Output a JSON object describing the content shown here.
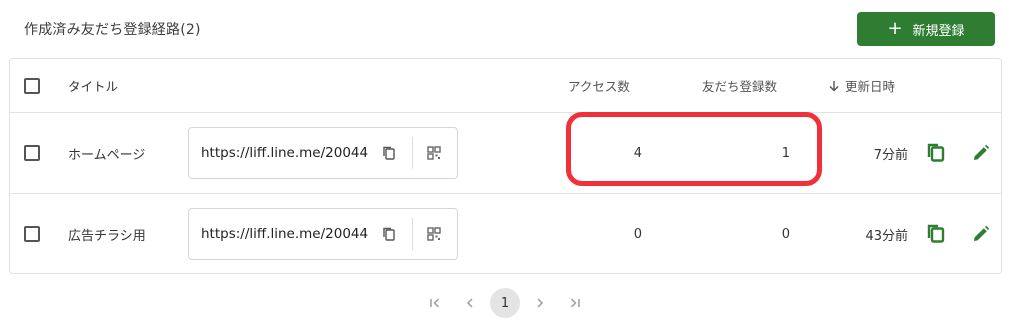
{
  "page": {
    "title": "作成済み友だち登録経路(2)",
    "new_button_label": "新規登録",
    "new_button_icon": "plus-icon"
  },
  "colors": {
    "accent_green": "#2f7d32",
    "highlight_red": "#f2303a"
  },
  "table": {
    "headers": {
      "title": "タイトル",
      "access": "アクセス数",
      "friends": "友だち登録数",
      "updated": "更新日時",
      "sort_icon": "arrow-down-icon"
    },
    "rows": [
      {
        "title": "ホームページ",
        "url": "https://liff.line.me/20044",
        "access": "4",
        "friends": "1",
        "updated": "7分前"
      },
      {
        "title": "広告チラシ用",
        "url": "https://liff.line.me/20044",
        "access": "0",
        "friends": "0",
        "updated": "43分前"
      }
    ]
  },
  "pagination": {
    "current": "1",
    "icons": [
      "first-page-icon",
      "prev-page-icon",
      "next-page-icon",
      "last-page-icon"
    ]
  }
}
